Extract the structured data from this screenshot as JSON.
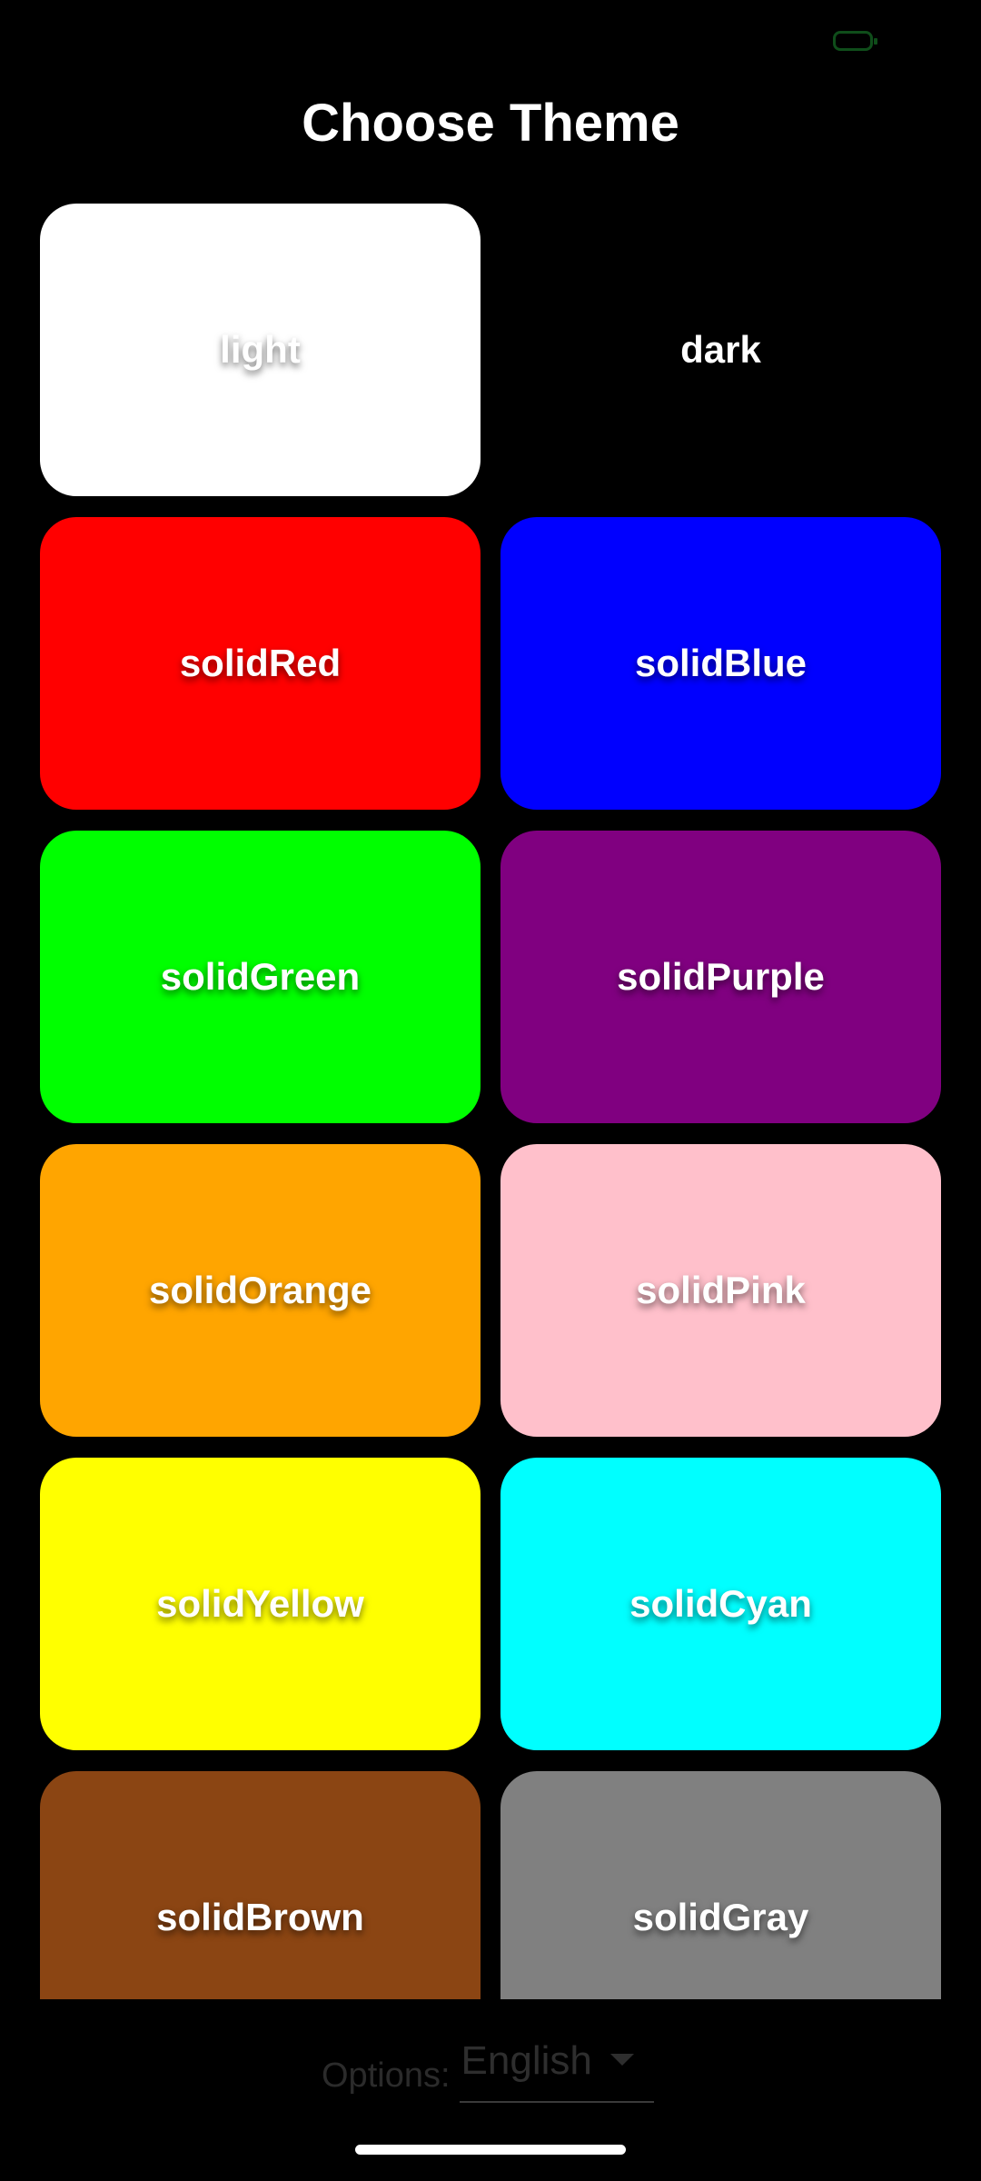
{
  "status_bar": {
    "battery_icon": "battery-icon",
    "battery_color": "#0f4d1a"
  },
  "title": "Choose Theme",
  "themes": [
    {
      "label": "light",
      "color": "#ffffff"
    },
    {
      "label": "dark",
      "color": "#000000"
    },
    {
      "label": "solidRed",
      "color": "#ff0000"
    },
    {
      "label": "solidBlue",
      "color": "#0000ff"
    },
    {
      "label": "solidGreen",
      "color": "#00ff00"
    },
    {
      "label": "solidPurple",
      "color": "#800080"
    },
    {
      "label": "solidOrange",
      "color": "#ffa500"
    },
    {
      "label": "solidPink",
      "color": "#ffc0cb"
    },
    {
      "label": "solidYellow",
      "color": "#ffff00"
    },
    {
      "label": "solidCyan",
      "color": "#00ffff"
    },
    {
      "label": "solidBrown",
      "color": "#8b4513"
    },
    {
      "label": "solidGray",
      "color": "#808080"
    }
  ],
  "footer": {
    "options_label": "Options:",
    "language_value": "English",
    "dropdown_icon": "chevron-down-icon"
  }
}
